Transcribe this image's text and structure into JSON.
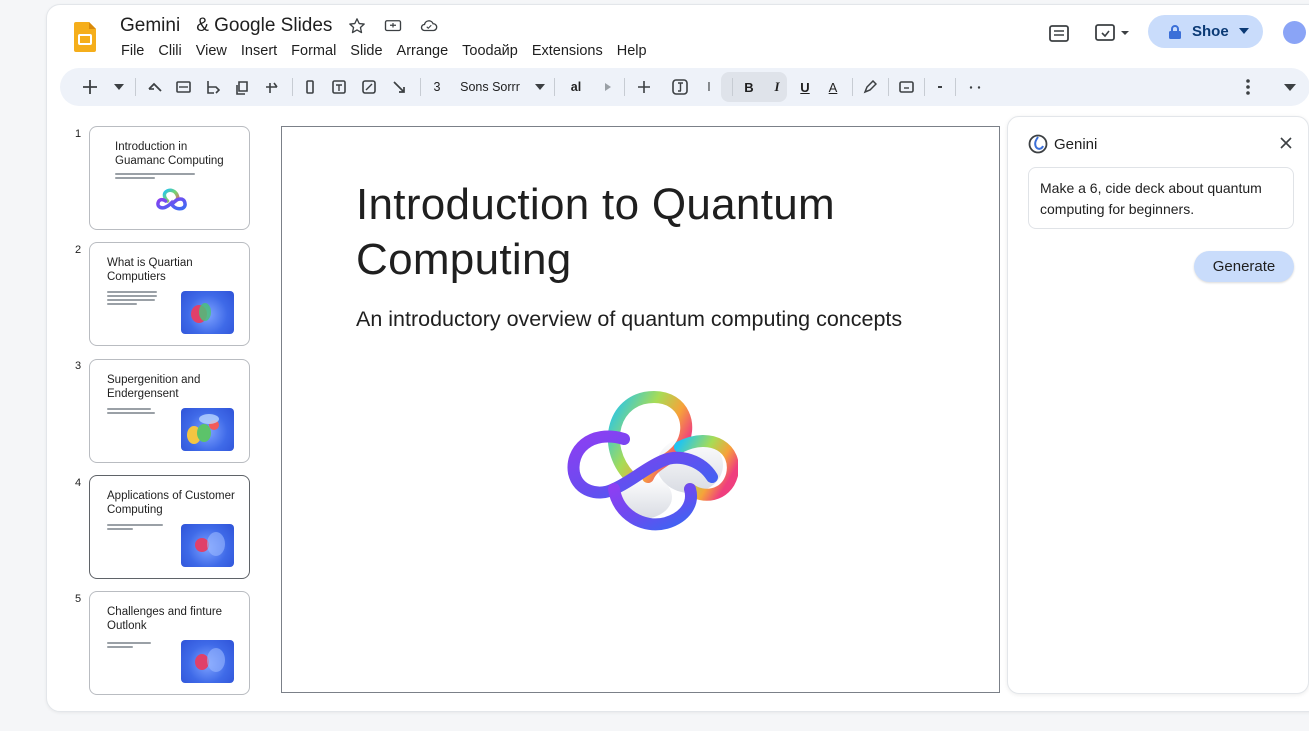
{
  "app": {
    "name": "Gemini",
    "doc_title": "& Google Slides"
  },
  "menu": [
    "File",
    "Clili",
    "View",
    "Insert",
    "Formal",
    "Slide",
    "Arrange",
    "Toodайp",
    "Extensions",
    "Help"
  ],
  "share": {
    "label": "Shoe"
  },
  "toolbar": {
    "zoom": "3",
    "font": "Sons Sorrr",
    "text_ai": "al",
    "bold": "B",
    "italic": "I",
    "underline": "U",
    "text_color": "A",
    "cursor_glyph": "I"
  },
  "slides": [
    {
      "num": "1",
      "title": "Introduction in Guamanc Computing"
    },
    {
      "num": "2",
      "title": "What is Quartian Computiers"
    },
    {
      "num": "3",
      "title": "Supergenition and Endergensent"
    },
    {
      "num": "4",
      "title": "Applications of Customer Computing"
    },
    {
      "num": "5",
      "title": "Challenges and finture Outlonk"
    }
  ],
  "canvas": {
    "title": "Introduction to Quantum Computing",
    "subtitle": "An introductory overview  of quantum computing concepts"
  },
  "panel": {
    "title": "Genini",
    "prompt": "Make a 6, cide deck about quantum computing for beginners.",
    "generate_label": "Generate"
  },
  "colors": {
    "accent_blue": "#c9dcfb",
    "avatar": "#8aa4f6",
    "doc_icon": "#f5ae1b"
  }
}
